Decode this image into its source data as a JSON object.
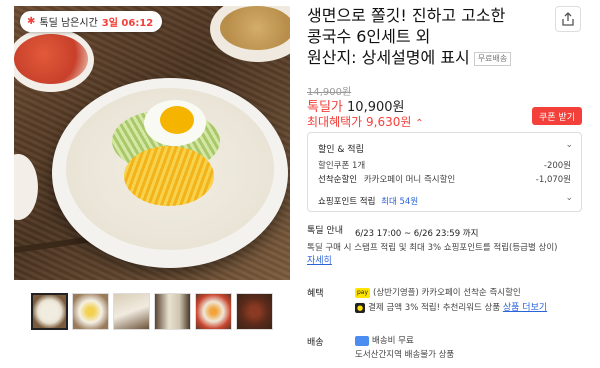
{
  "timer": {
    "label": "톡딜 남은시간",
    "time": "3일 06:12"
  },
  "product": {
    "title_line1": "생면으로 쫄깃! 진하고 고소한",
    "title_line2": "콩국수 6인세트 외",
    "title_line3": "원산지: 상세설명에 표시",
    "shipping_tag": "무료배송"
  },
  "price": {
    "original": "14,900원",
    "deal_label": "톡딜가",
    "deal_price": "10,900원",
    "max_label": "최대혜택가",
    "max_price": "9,630원",
    "coupon_button": "쿠폰 받기"
  },
  "discount_box": {
    "header": "할인 & 적립",
    "coupon_label": "할인쿠폰 1개",
    "coupon_value": "-200원",
    "prepay_label": "선착순할인",
    "prepay_desc": "카카오페이 머니 즉시할인",
    "prepay_value": "-1,070원",
    "points_label": "쇼핑포인트 적립",
    "points_max": "최대 54원"
  },
  "talk_deal": {
    "label": "톡딜 안내",
    "period": "6/23 17:00 ~ 6/26 23:59 까지",
    "desc": "톡딜 구매 시 스탬프 적립 및 최대 3% 쇼핑포인트를 적립(등급별 상이)",
    "more_link": "자세히"
  },
  "benefits": {
    "label": "혜택",
    "line1": "(상반기영플) 카카오페이 선착순 즉시할인",
    "line1_badge": "pay",
    "line2_text": "결제 금액 3% 적립! 추천리워드 상품",
    "line2_link": "상품 더보기"
  },
  "delivery": {
    "label": "배송",
    "line1": "배송비 무료",
    "line2": "도서산간지역 배송불가 상품"
  },
  "icons": {
    "timer": "fire-icon",
    "share": "share-icon",
    "chevron": "chevron-down-icon",
    "truck": "truck-icon"
  },
  "colors": {
    "accent": "#f3403a",
    "link": "#2b63d9",
    "kakao_yellow": "#ffe400"
  }
}
